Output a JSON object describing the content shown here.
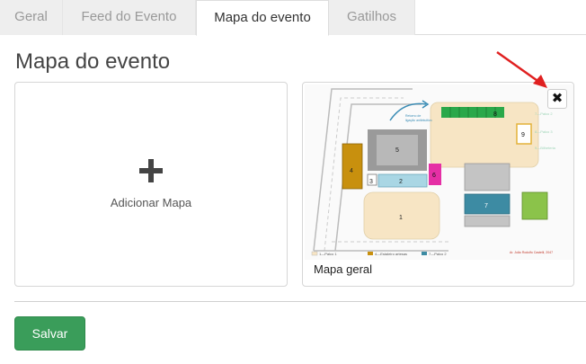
{
  "tabs": [
    {
      "label": "Geral",
      "active": false
    },
    {
      "label": "Feed do Evento",
      "active": false
    },
    {
      "label": "Mapa do evento",
      "active": true
    },
    {
      "label": "Gatilhos",
      "active": false
    }
  ],
  "page_title": "Mapa do evento",
  "add_map": {
    "label": "Adicionar Mapa",
    "icon": "plus-icon"
  },
  "map_card": {
    "caption": "Mapa geral",
    "remove_icon": "close-icon",
    "map_labels": {
      "areas": [
        "1",
        "2",
        "3",
        "4",
        "5",
        "6",
        "7",
        "8",
        "9"
      ],
      "return_note": "Retorno de ligação antiintuitivo",
      "legend": [
        "1—Palco 1",
        "4—Estaleiro artesas",
        "7—Palco 2"
      ],
      "credit": "Ar. João Rodolfo Castelli, 2047"
    }
  },
  "annotation": {
    "arrow_color": "#e02020"
  },
  "footer": {
    "save_label": "Salvar"
  },
  "colors": {
    "save": "#3a9d5a",
    "tab_bg": "#eeeeee"
  }
}
